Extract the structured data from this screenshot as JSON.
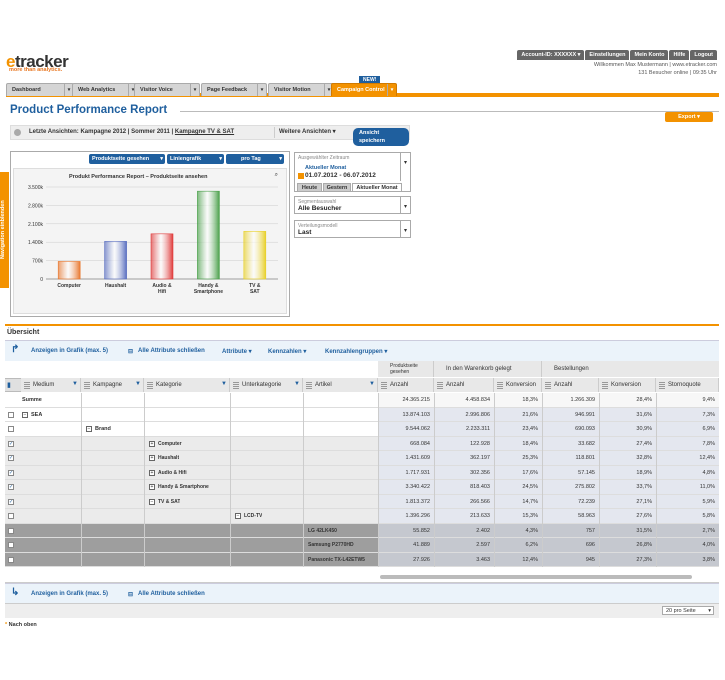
{
  "brand": {
    "logo_e": "e",
    "logo_rest": "tracker",
    "tagline": "more than analytics."
  },
  "topnav": [
    "Account-ID: XXXXXX ▾",
    "Einstellungen",
    "Mein Konto",
    "Hilfe",
    "Logout"
  ],
  "welcome": {
    "line1": "Willkommen Max Mustermann | www.etracker.com",
    "line2": "131 Besucher online | 09:35 Uhr"
  },
  "tabs": [
    "Dashboard",
    "Web Analytics",
    "Visitor Voice",
    "Page Feedback",
    "Visitor Motion",
    "Campaign Control"
  ],
  "new_badge": "NEW!",
  "page_title": "Product Performance Report",
  "export_label": "Export",
  "side_tab": "Navigation einblenden",
  "last_views": {
    "label": "Letzte Ansichten:",
    "items": "Kampagne 2012 | Sommer 2011 |",
    "link": "Kampagne TV & SAT",
    "more": "Weitere Ansichten ▾",
    "save": "Ansicht speichern"
  },
  "chart_controls": {
    "metric": "Produktseite gesehen",
    "type": "Liniengrafik",
    "interval": "pro Tag"
  },
  "chart_data": {
    "type": "bar",
    "title": "Produkt Performance Report – Produktseite ansehen",
    "categories": [
      "Computer",
      "Haushalt",
      "Audio & Hifi",
      "Handy & Smartphone",
      "TV & SAT"
    ],
    "values": [
      668084,
      1431609,
      1717931,
      3340422,
      1813372
    ],
    "ylim": [
      0,
      3500000
    ],
    "yticks": [
      "0",
      "700k",
      "1.400k",
      "2.100k",
      "2.800k",
      "3.500k"
    ],
    "colors": [
      "#e8772e",
      "#5a6fc0",
      "#e03b3b",
      "#4aa04a",
      "#e8d02a"
    ]
  },
  "period": {
    "label": "Ausgewählter Zeitraum",
    "sub": "Aktueller Monat",
    "value": "01.07.2012 - 06.07.2012",
    "tabs": [
      "Heute",
      "Gestern",
      "Aktueller Monat"
    ]
  },
  "segment": {
    "label": "Segmentauswahl",
    "value": "Alle Besucher"
  },
  "distribution": {
    "label": "Verteilungsmodell",
    "value": "Last"
  },
  "overview": "Übersicht",
  "toolbar": {
    "show": "Anzeigen in Grafik (max. 5)",
    "close_all": "Alle Attribute schließen",
    "attribute": "Attribute ▾",
    "kennzahlen": "Kennzahlen ▾",
    "groups": "Kennzahlengruppen ▾"
  },
  "groups": [
    "Produktseite gesehen",
    "In den Warenkorb gelegt",
    "Bestellungen"
  ],
  "dims": [
    "Medium",
    "Kampagne",
    "Kategorie",
    "Unterkategorie",
    "Artikel"
  ],
  "metrics": [
    "Anzahl",
    "Anzahl",
    "Konversion",
    "Anzahl",
    "Konversion",
    "Stornoquote"
  ],
  "rows": [
    {
      "label": "Summe",
      "level": 0,
      "vals": [
        "24.365.215",
        "4.458.834",
        "18,3%",
        "1.266.309",
        "28,4%",
        "9,4%"
      ]
    },
    {
      "label": "SEA",
      "level": 0,
      "vals": [
        "13.874.103",
        "2.996.806",
        "21,6%",
        "946.991",
        "31,6%",
        "7,3%"
      ]
    },
    {
      "label": "Brand",
      "level": 1,
      "vals": [
        "9.544.062",
        "2.233.311",
        "23,4%",
        "690.093",
        "30,9%",
        "6,9%"
      ]
    },
    {
      "label": "Computer",
      "level": 2,
      "vals": [
        "668.084",
        "122.928",
        "18,4%",
        "33.682",
        "27,4%",
        "7,8%"
      ]
    },
    {
      "label": "Haushalt",
      "level": 2,
      "vals": [
        "1.431.609",
        "362.197",
        "25,3%",
        "118.801",
        "32,8%",
        "12,4%"
      ]
    },
    {
      "label": "Audio & Hifi",
      "level": 2,
      "vals": [
        "1.717.931",
        "302.356",
        "17,6%",
        "57.145",
        "18,9%",
        "4,8%"
      ]
    },
    {
      "label": "Handy & Smartphone",
      "level": 2,
      "vals": [
        "3.340.422",
        "818.403",
        "24,5%",
        "275.802",
        "33,7%",
        "11,0%"
      ]
    },
    {
      "label": "TV & SAT",
      "level": 2,
      "vals": [
        "1.813.372",
        "266.566",
        "14,7%",
        "72.239",
        "27,1%",
        "5,9%"
      ]
    },
    {
      "label": "LCD-TV",
      "level": 3,
      "vals": [
        "1.396.296",
        "213.633",
        "15,3%",
        "58.963",
        "27,6%",
        "5,8%"
      ]
    },
    {
      "label": "LG 42LK450",
      "level": 4,
      "vals": [
        "55.852",
        "2.402",
        "4,3%",
        "757",
        "31,5%",
        "2,7%"
      ]
    },
    {
      "label": "Samsung P2770HD",
      "level": 4,
      "vals": [
        "41.889",
        "2.597",
        "6,2%",
        "696",
        "26,8%",
        "4,0%"
      ]
    },
    {
      "label": "Panasonic TX-L42ETW5",
      "level": 4,
      "vals": [
        "27.926",
        "3.463",
        "12,4%",
        "945",
        "27,3%",
        "3,8%"
      ]
    }
  ],
  "per_page": "20 pro Seite",
  "footnote": "Nach oben"
}
